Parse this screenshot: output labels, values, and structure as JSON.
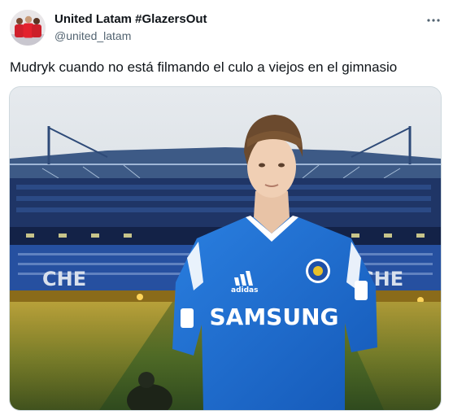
{
  "author": {
    "name": "United Latam #GlazersOut",
    "handle": "@united_latam"
  },
  "tweet": {
    "text": "Mudryk cuando no está filmando el culo a viejos en el gimnasio"
  },
  "media": {
    "shirt_sponsor": "SAMSUNG",
    "kit_brand": "adidas",
    "stand_letters": "CHE"
  },
  "icons": {
    "more": "more-horizontal-icon"
  },
  "colors": {
    "name_text": "#0f1419",
    "handle_text": "#536471",
    "kit_blue": "#1f6fd6",
    "pitch_green": "#3f6b2a"
  }
}
